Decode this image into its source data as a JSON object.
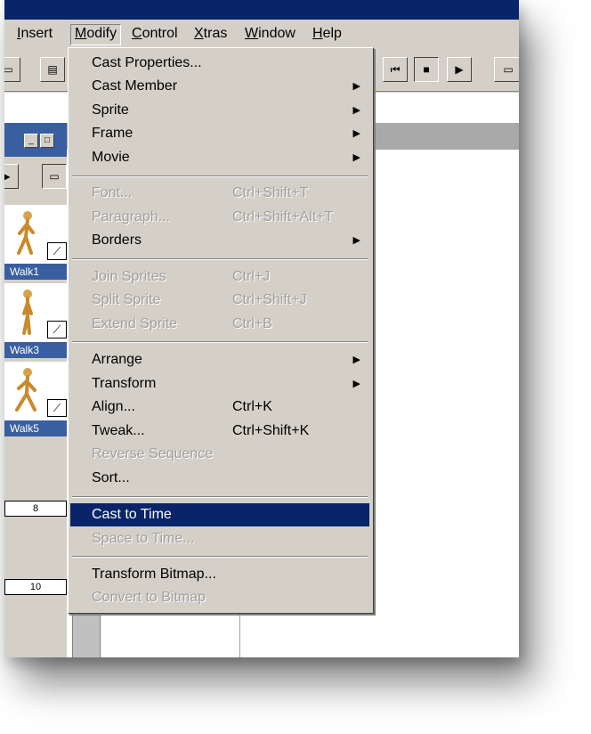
{
  "menubar": {
    "items": [
      "Insert",
      "Modify",
      "Control",
      "Xtras",
      "Window",
      "Help"
    ],
    "underline": [
      "I",
      "M",
      "C",
      "X",
      "W",
      "H"
    ]
  },
  "cast": [
    {
      "label": "Walk1"
    },
    {
      "label": "Walk3"
    },
    {
      "label": "Walk5"
    }
  ],
  "frames": [
    "8",
    "10"
  ],
  "modify_menu": {
    "cast_properties": "Cast Properties...",
    "cast_member": "Cast Member",
    "sprite": "Sprite",
    "frame": "Frame",
    "movie": "Movie",
    "font": "Font...",
    "font_sc": "Ctrl+Shift+T",
    "paragraph": "Paragraph...",
    "paragraph_sc": "Ctrl+Shift+Alt+T",
    "borders": "Borders",
    "join_sprites": "Join Sprites",
    "join_sprites_sc": "Ctrl+J",
    "split_sprite": "Split Sprite",
    "split_sprite_sc": "Ctrl+Shift+J",
    "extend_sprite": "Extend Sprite",
    "extend_sprite_sc": "Ctrl+B",
    "arrange": "Arrange",
    "transform": "Transform",
    "align": "Align...",
    "align_sc": "Ctrl+K",
    "tweak": "Tweak...",
    "tweak_sc": "Ctrl+Shift+K",
    "reverse_sequence": "Reverse Sequence",
    "sort": "Sort...",
    "cast_to_time": "Cast to Time",
    "space_to_time": "Space to Time...",
    "transform_bitmap": "Transform Bitmap...",
    "convert_to_bitmap": "Convert to Bitmap"
  },
  "colors": {
    "titlebar": "#0a246a",
    "highlight": "#0a246a",
    "face": "#d4d0c8",
    "cast_label": "#3a5fa0"
  }
}
